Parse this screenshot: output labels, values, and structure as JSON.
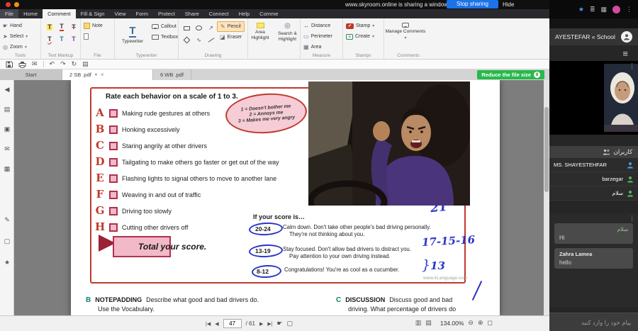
{
  "icons": {
    "caret": "▾",
    "close": "×",
    "kebab": "⋮",
    "hamburger": "≡",
    "star": "★",
    "grid": "▦",
    "lines": "≣",
    "hand": "☛",
    "select": "➤",
    "zoom": "◎",
    "t": "T",
    "plus": "+",
    "check": "✔",
    "envelope": "✉",
    "undo": "↶",
    "redo": "↷",
    "refresh": "↻",
    "pagepanel": "▤",
    "arrow_ne": "↗",
    "wave": "∿",
    "pencil": "✎",
    "eraser": "◪",
    "distance": "↔",
    "perimeter": "▭",
    "area": "▦",
    "collapse": "◀",
    "thumbs": "▤",
    "bookmark": "▣",
    "attach": "✉",
    "layers": "▦",
    "signature": "✎",
    "commentpanel": "▢",
    "stamppanel": "★",
    "nav_first": "|◀",
    "nav_prev": "◀",
    "nav_next": "▶",
    "nav_last": "▶|",
    "hand_tool": "☛",
    "marquee": "▢",
    "layout1": "▥",
    "layout2": "▤",
    "zoom_out": "⊖",
    "zoom_in": "⊕",
    "fullscreen": "◻"
  },
  "share_bar": {
    "message": "www.skyroom.online is sharing a window.",
    "stop": "Stop sharing",
    "hide": "Hide"
  },
  "ribbon_tabs": [
    "File",
    "Home",
    "Comment",
    "Fill & Sign",
    "View",
    "Form",
    "Protect",
    "Share",
    "Connect",
    "Help",
    "Comme"
  ],
  "ribbon": {
    "tools": {
      "label": "Tools",
      "hand": "Hand",
      "select": "Select",
      "zoom": "Zoom"
    },
    "markup": {
      "label": "Text Markup"
    },
    "file": {
      "label": "File",
      "note": "Note"
    },
    "typewriter": {
      "label": "Typewriter",
      "main": "Typewriter",
      "callout": "Callout",
      "textbox": "Textbox"
    },
    "drawing": {
      "label": "Drawing",
      "pencil": "Pencil",
      "eraser": "Eraser"
    },
    "highlight": {
      "area": "Area Highlight",
      "search": "Search & Highlight"
    },
    "measure": {
      "label": "Measure",
      "distance": "Distance",
      "perimeter": "Perimeter",
      "area": "Area"
    },
    "stamps": {
      "label": "Stamps",
      "stamp": "Stamp",
      "create": "Create"
    },
    "comments": {
      "label": "Comments",
      "manage": "Manage Comments"
    }
  },
  "doc_tabs": {
    "tab1": "Start",
    "tab2": "2 SB .pdf",
    "tab3": "6 WB .pdf",
    "reduce": "Reduce the file size",
    "badge": "8"
  },
  "page": {
    "title": "Rate each behavior on a scale of 1 to 3.",
    "items": [
      {
        "letter": "A",
        "text": "Making rude gestures at others"
      },
      {
        "letter": "B",
        "text": "Honking excessively"
      },
      {
        "letter": "C",
        "text": "Staring angrily at other drivers"
      },
      {
        "letter": "D",
        "text": "Tailgating to make others go faster or get out of the way"
      },
      {
        "letter": "E",
        "text": "Flashing lights to signal others to move to another lane"
      },
      {
        "letter": "F",
        "text": "Weaving in and out of traffic"
      },
      {
        "letter": "G",
        "text": "Driving too slowly"
      },
      {
        "letter": "H",
        "text": "Cutting other drivers off"
      }
    ],
    "legend": [
      "1 = Doesn't bother me",
      "2 = Annoys me",
      "3 = Makes me very angry"
    ],
    "total": "Total your score.",
    "score_heading": "If your score is…",
    "scores": [
      {
        "range": "20-24",
        "line1": "Calm down. Don't take other people's bad driving personally.",
        "line2": "They're not thinking about you."
      },
      {
        "range": "13-19",
        "line1": "Stay focused. Don't allow bad drivers to distract you.",
        "line2": "Pay attention to your own driving instead."
      },
      {
        "range": "8-12",
        "line1": "Congratulations! You're as cool as a cucumber.",
        "line2": ""
      }
    ],
    "handwriting": {
      "top": "21",
      "middle": "17-15-16",
      "brace": "}",
      "bottom": "13"
    },
    "watermark": "www.irLanguage.com",
    "tasks": [
      {
        "letter": "B",
        "heading": "NOTEPADDING",
        "line1": "Describe what good and bad drivers do.",
        "line2": "Use the Vocabulary."
      },
      {
        "letter": "C",
        "heading": "DISCUSSION",
        "line1": "Discuss good and bad",
        "line2": "driving. What percentage of drivers do"
      }
    ]
  },
  "status": {
    "page": "47",
    "total": "/ 61",
    "zoom": "134.00%"
  },
  "panel": {
    "title": "AYESTEFAR « School",
    "users_header": "کاربران",
    "users": [
      {
        "name": "MS. SHAYESTEHFAR"
      },
      {
        "name": "barzegar"
      },
      {
        "name": "سلام"
      }
    ],
    "chat": [
      {
        "name": "سلام",
        "message": "Hi"
      },
      {
        "name": "Zahra Lamea",
        "message": "hello"
      }
    ],
    "placeholder": "پیام خود را وارد کنید"
  }
}
